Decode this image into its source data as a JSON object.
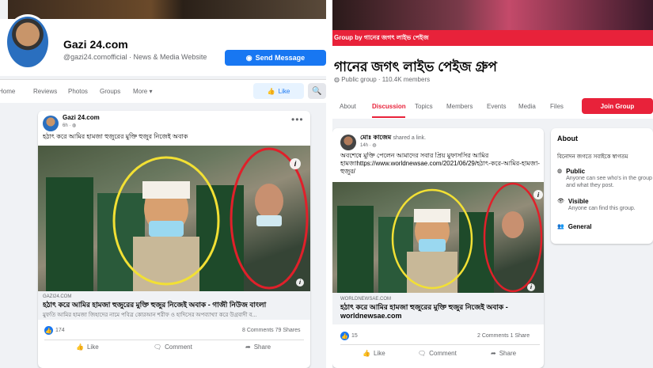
{
  "left": {
    "page_name": "Gazi 24.com",
    "handle_category": "@gazi24.comofficial · News & Media Website",
    "send_message": "Send Message",
    "tabs": [
      "Home",
      "Reviews",
      "Photos",
      "Groups",
      "More ▾"
    ],
    "like_button": "Like",
    "post": {
      "author": "Gazi 24.com",
      "time": "6h · ◍",
      "text": "হঠাৎ করে আমির হামজা হুজুরের মুক্তি হুজুর নিজেই অবাক",
      "domain": "GAZI24.COM",
      "link_title": "হঠাৎ করে আমির হামজা হুজুরের মুক্তি হুজুর নিজেই অবাক - গাজী নিউজ বাংলা",
      "link_desc": "মুফতি আমির হামজা জিহাদের নামে পবিত্র কোরআন শরীফ ও হাদিসের অপব্যাখ্যা করে উগ্রবাদী ব...",
      "reactions": "174",
      "counts": "8 Comments  79 Shares",
      "actions": [
        "Like",
        "Comment",
        "Share"
      ]
    }
  },
  "right": {
    "cover_label": "Group by গানের জগৎ লাইভ পেইজ",
    "group_name": "গানের জগৎ লাইভ পেইজ গ্রুপ",
    "group_sub": "Public group · 110.4K members",
    "tabs": [
      "About",
      "Discussion",
      "Topics",
      "Members",
      "Events",
      "Media",
      "Files"
    ],
    "join": "Join Group",
    "post": {
      "author": "মোঃ কাজেম",
      "shared": "shared a link.",
      "time": "14h · ◍",
      "text": "অবশেষে মুক্তি পেলেন আমাদের সবার প্রিয় মুফাসসির আমির হামজাhttps://www.worldnewsae.com/2021/06/29/হঠাৎ-করে-আমির-হামজা-হুজুর/",
      "domain": "WORLDNEWSAE.COM",
      "link_title": "হঠাৎ করে আমির হামজা হুজুরের মুক্তি হুজুর নিজেই অবাক - worldnewsae.com",
      "reactions": "15",
      "counts": "2 Comments  1 Share",
      "actions": [
        "Like",
        "Comment",
        "Share"
      ]
    },
    "about": {
      "title": "About",
      "intro": "বিনোদন জগতে সবাইকে স্বাগতম",
      "public": "Public",
      "public_desc": "Anyone can see who's in the group and what they post.",
      "visible": "Visible",
      "visible_desc": "Anyone can find this group.",
      "general": "General"
    }
  },
  "colors": {
    "fb_blue": "#1877f2",
    "group_red": "#e8223a",
    "photo_circle": "#f2e034",
    "photo_circle_red": "#e0202a"
  }
}
